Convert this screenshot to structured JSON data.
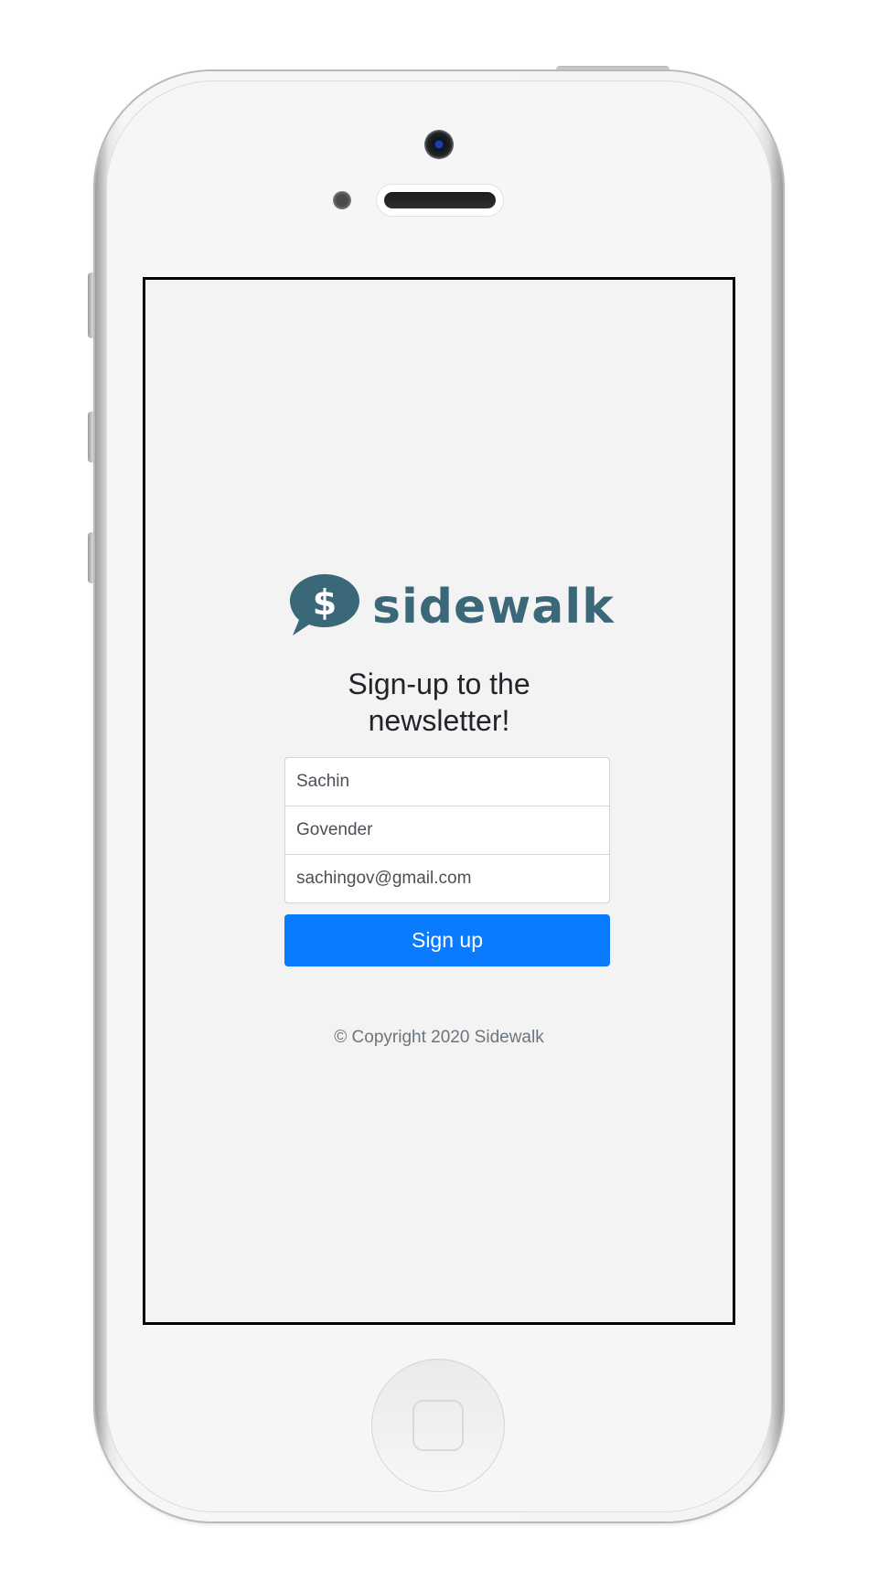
{
  "brand": {
    "name": "sidewalk",
    "icon": "dollar-speech-bubble-icon",
    "color": "#3a6878"
  },
  "page": {
    "heading_line1": "Sign-up to the",
    "heading_line2": "newsletter!"
  },
  "form": {
    "first_name_value": "Sachin",
    "last_name_value": "Govender",
    "email_value": "sachingov@gmail.com",
    "submit_label": "Sign up",
    "submit_color": "#0a7bff"
  },
  "footer": {
    "copyright": "© Copyright 2020 Sidewalk"
  }
}
